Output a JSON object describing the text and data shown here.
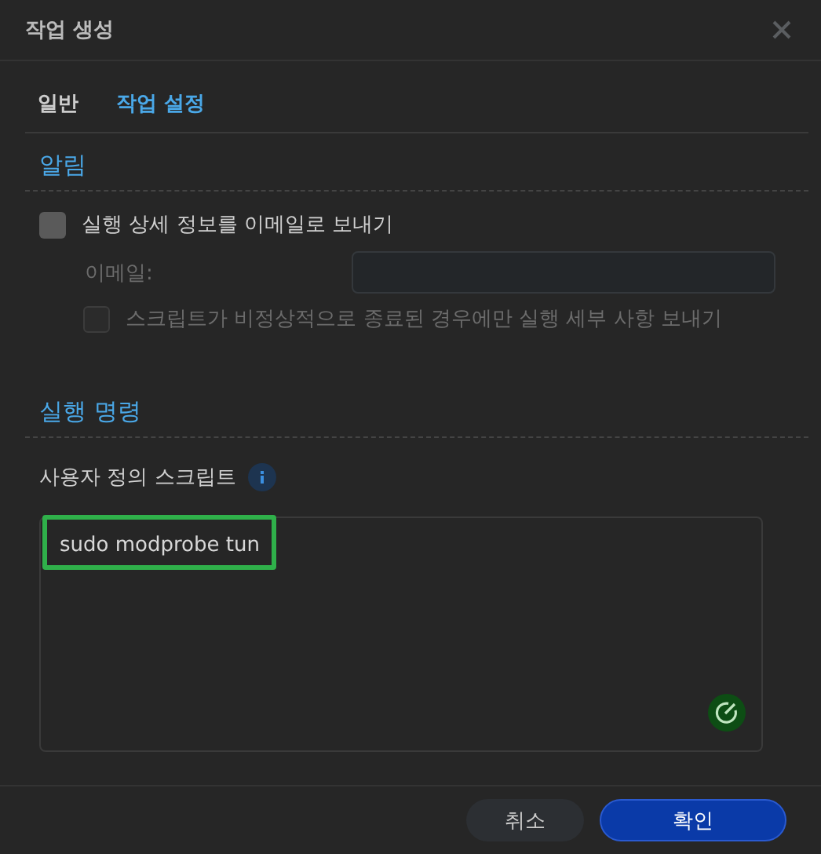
{
  "window": {
    "title": "작업 생성"
  },
  "tabs": [
    {
      "label": "일반",
      "selected": false
    },
    {
      "label": "작업 설정",
      "selected": true
    }
  ],
  "notification": {
    "heading": "알림",
    "send_email": {
      "label": "실행 상세 정보를 이메일로 보내기",
      "checked": false,
      "disabled": false
    },
    "email": {
      "label": "이메일:",
      "disabled": true
    },
    "only_abnormal": {
      "label": "스크립트가 비정상적으로 종료된 경우에만 실행 세부 사항 보내기",
      "checked": false,
      "disabled": true
    }
  },
  "run_command": {
    "heading": "실행 명령",
    "script_label": "사용자 정의 스크립트",
    "script": "sudo modprobe tun"
  },
  "buttons": [
    {
      "label": "취소",
      "kind": "secondary"
    },
    {
      "label": "확인",
      "kind": "primary"
    }
  ]
}
